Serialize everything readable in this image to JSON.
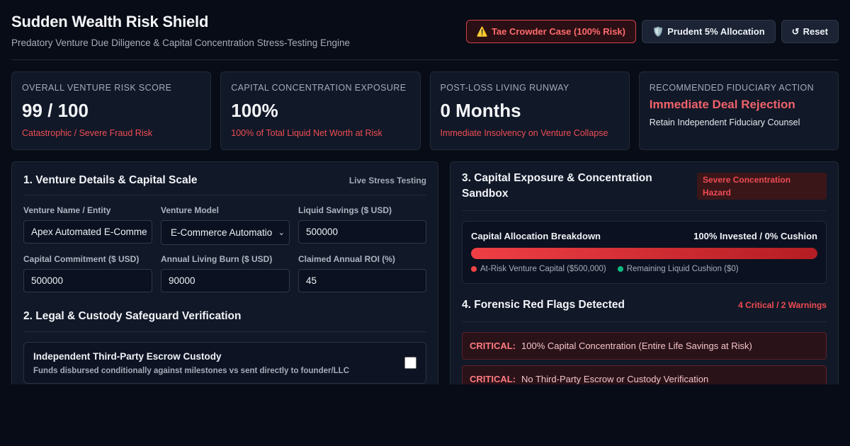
{
  "header": {
    "title": "Sudden Wealth Risk Shield",
    "subtitle": "Predatory Venture Due Diligence & Capital Concentration Stress-Testing Engine",
    "buttons": {
      "case_icon": "⚠️",
      "case_label": "Tae Crowder Case (100% Risk)",
      "prudent_icon": "🛡️",
      "prudent_label": "Prudent 5% Allocation",
      "reset_icon": "↺",
      "reset_label": "Reset"
    }
  },
  "stats": [
    {
      "label": "Overall Venture Risk Score",
      "value": "99 / 100",
      "note": "Catastrophic / Severe Fraud Risk"
    },
    {
      "label": "Capital Concentration Exposure",
      "value": "100%",
      "note": "100% of Total Liquid Net Worth at Risk"
    },
    {
      "label": "Post-Loss Living Runway",
      "value": "0 Months",
      "note": "Immediate Insolvency on Venture Collapse"
    },
    {
      "label": "Recommended Fiduciary Action",
      "value": "Immediate Deal Rejection",
      "note": "Retain Independent Fiduciary Counsel"
    }
  ],
  "venture": {
    "title": "1. Venture Details & Capital Scale",
    "tag": "Live Stress Testing",
    "fields": {
      "name": {
        "label": "Venture Name / Entity",
        "value": "Apex Automated E-Comme"
      },
      "model": {
        "label": "Venture Model",
        "value": "E-Commerce Automatio"
      },
      "savings": {
        "label": "Liquid Savings ($ USD)",
        "value": "500000"
      },
      "commitment": {
        "label": "Capital Commitment ($ USD)",
        "value": "500000"
      },
      "burn": {
        "label": "Annual Living Burn ($ USD)",
        "value": "90000"
      },
      "roi": {
        "label": "Claimed Annual ROI (%)",
        "value": "45"
      }
    }
  },
  "legal": {
    "title": "2. Legal & Custody Safeguard Verification",
    "escrow": {
      "title": "Independent Third-Party Escrow Custody",
      "desc": "Funds disbursed conditionally against milestones vs sent directly to founder/LLC",
      "checked": false
    }
  },
  "exposure": {
    "title": "3. Capital Exposure & Concentration Sandbox",
    "badge": "Severe Concentration Hazard",
    "breakdown_title": "Capital Allocation Breakdown",
    "breakdown_summary": "100% Invested / 0% Cushion",
    "invested_fraction": 1.0,
    "legend": {
      "at_risk": "At-Risk Venture Capital ($500,000)",
      "cushion": "Remaining Liquid Cushion ($0)"
    },
    "colors": {
      "at_risk": "#ef4444",
      "cushion": "#10b981"
    }
  },
  "flags": {
    "title": "4. Forensic Red Flags Detected",
    "summary": "4 Critical / 2 Warnings",
    "items": [
      {
        "kind": "CRITICAL:",
        "text": "100% Capital Concentration (Entire Life Savings at Risk)"
      },
      {
        "kind": "CRITICAL:",
        "text": "No Third-Party Escrow or Custody Verification"
      }
    ]
  }
}
